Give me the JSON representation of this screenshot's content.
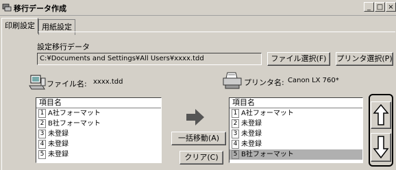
{
  "window": {
    "title": "移行データ作成",
    "minimize": "_",
    "restore": "□",
    "close": "×"
  },
  "tabs": [
    "印刷設定",
    "用紙設定"
  ],
  "migrate": {
    "label": "設定移行データ",
    "path": "C:¥Documents and Settings¥All Users¥xxxx.tdd",
    "file_button": "ファイル選択(F)",
    "printer_button": "プリンタ選択(P)"
  },
  "file_info": {
    "label": "ファイル名:",
    "value": "xxxx.tdd"
  },
  "printer_info": {
    "label": "プリンタ名:",
    "value": "Canon LX 760*"
  },
  "left_list": {
    "header": "項目名",
    "items": [
      {
        "num": "1",
        "name": "A社フォーマット"
      },
      {
        "num": "2",
        "name": "B社フォーマット"
      },
      {
        "num": "3",
        "name": "未登録"
      },
      {
        "num": "4",
        "name": "未登録"
      },
      {
        "num": "5",
        "name": "未登録"
      }
    ]
  },
  "right_list": {
    "header": "項目名",
    "items": [
      {
        "num": "1",
        "name": "A社フォーマット"
      },
      {
        "num": "2",
        "name": "未登録"
      },
      {
        "num": "3",
        "name": "未登録"
      },
      {
        "num": "4",
        "name": "未登録"
      },
      {
        "num": "5",
        "name": "B社フォーマット"
      }
    ]
  },
  "buttons": {
    "move_all": "一括移動(A)",
    "clear": "クリア(C)"
  },
  "icons": {
    "app": "app-icon",
    "pc": "computer-icon",
    "printer": "printer-icon",
    "move": "right-arrow-icon",
    "up": "up-arrow-icon",
    "down": "down-arrow-icon"
  }
}
